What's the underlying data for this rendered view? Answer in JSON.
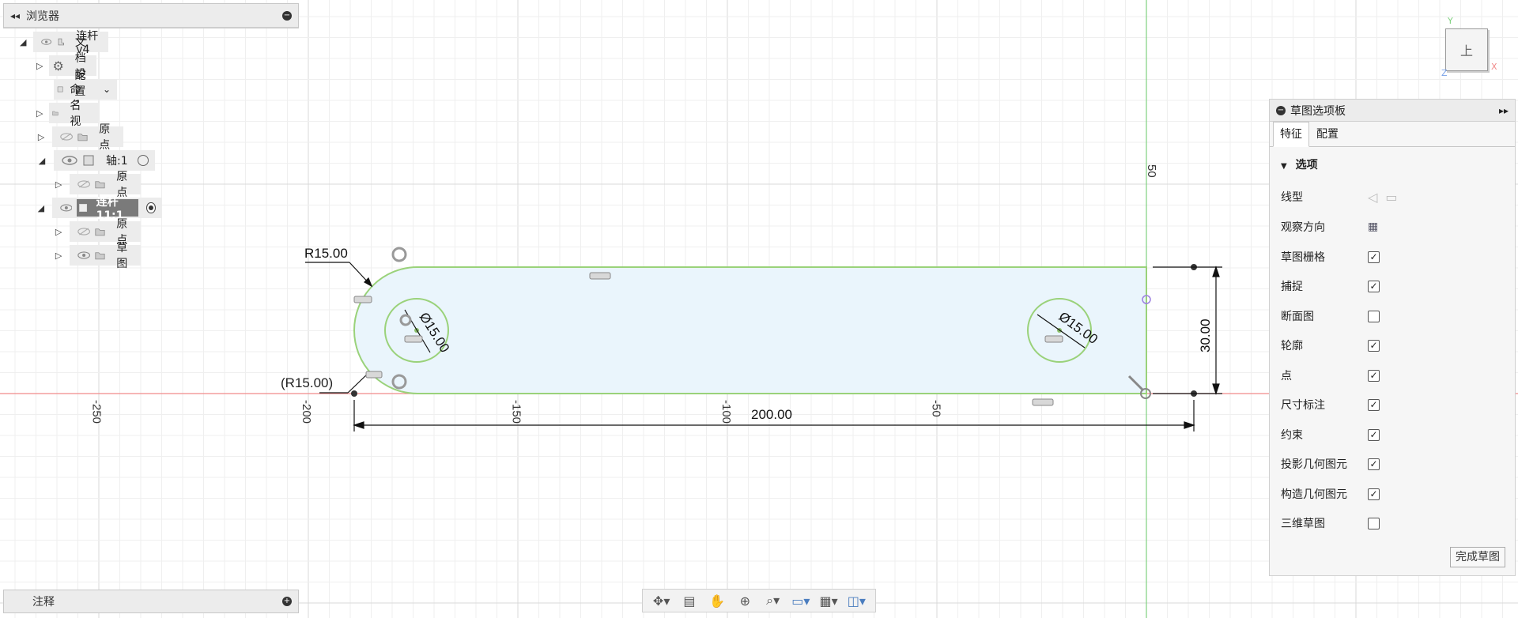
{
  "browser": {
    "title": "浏览器",
    "collapse_icon": "double-chevron-left-icon",
    "items": [
      {
        "label": "连杆 v4"
      },
      {
        "label": "文档设置"
      },
      {
        "label": "配置 1"
      },
      {
        "label": "命名视图"
      },
      {
        "label": "原点"
      },
      {
        "label": "轴:1"
      },
      {
        "label": "原点"
      },
      {
        "label": "连杆11:1"
      },
      {
        "label": "原点"
      },
      {
        "label": "草图"
      }
    ]
  },
  "annotations_panel": {
    "title": "注释"
  },
  "sketch_palette": {
    "title": "草图选项板",
    "tabs": [
      {
        "label": "特征"
      },
      {
        "label": "配置"
      }
    ],
    "section": "选项",
    "options": [
      {
        "label": "线型",
        "kind": "icons"
      },
      {
        "label": "观察方向",
        "kind": "icon"
      },
      {
        "label": "草图栅格",
        "checked": true
      },
      {
        "label": "捕捉",
        "checked": true
      },
      {
        "label": "断面图",
        "checked": false
      },
      {
        "label": "轮廓",
        "checked": true
      },
      {
        "label": "点",
        "checked": true
      },
      {
        "label": "尺寸标注",
        "checked": true
      },
      {
        "label": "约束",
        "checked": true
      },
      {
        "label": "投影几何图元",
        "checked": true
      },
      {
        "label": "构造几何图元",
        "checked": true
      },
      {
        "label": "三维草图",
        "checked": false
      }
    ],
    "finish_button": "完成草图"
  },
  "sketch": {
    "dimensions": {
      "radius_label": "R15.00",
      "radius_ref_label": "(R15.00)",
      "dia_left": "Ø15.00",
      "dia_right": "Ø15.00",
      "length": "200.00",
      "height": "30.00"
    },
    "axis_ticks": {
      "x": [
        "-250",
        "-200",
        "-150",
        "-100",
        "-50"
      ],
      "y": [
        "50"
      ]
    }
  },
  "viewcube": {
    "face": "上",
    "axes": [
      "Y",
      "X",
      "Z"
    ]
  },
  "toolbar": {
    "icons": [
      "orbit-icon",
      "look-at-icon",
      "pan-icon",
      "zoom-window-icon",
      "zoom-icon",
      "display-settings-icon",
      "grid-settings-icon",
      "viewports-icon"
    ]
  },
  "colors": {
    "x_axis": "#f08a8a",
    "y_axis": "#7ed07e",
    "profile_fill": "#e8f4fb",
    "profile_edge": "#9ad27a"
  }
}
